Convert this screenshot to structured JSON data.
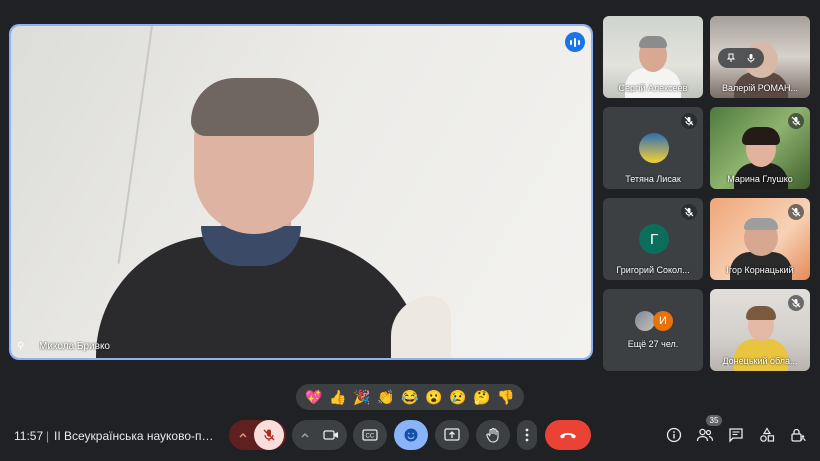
{
  "main": {
    "speaker_name": "Микола Бривко",
    "pin_glyph": "⚲"
  },
  "tiles": [
    {
      "name": "Сергій Алексеев",
      "type": "video"
    },
    {
      "name": "Валерій РОМАН...",
      "type": "video"
    },
    {
      "name": "Тетяна Лисак",
      "type": "avatar-image"
    },
    {
      "name": "Марина Глушко",
      "type": "video"
    },
    {
      "name": "Григорий Сокол...",
      "type": "avatar",
      "initial": "Г",
      "avatar_color": "#0b6e5a"
    },
    {
      "name": "Ігор Корнацький",
      "type": "video"
    },
    {
      "name": "Ещё 27 чел.",
      "type": "more",
      "initial": "И",
      "avatar_color": "#e8710a"
    },
    {
      "name": "Донецький обла...",
      "type": "video"
    }
  ],
  "reactions": [
    "💖",
    "👍",
    "🎉",
    "👏",
    "😂",
    "😮",
    "😢",
    "🤔",
    "👎"
  ],
  "bottom": {
    "time": "11:57",
    "separator": "|",
    "meeting_title": "II Всеукраїнська науково-практ...",
    "participant_count": "35"
  },
  "colors": {
    "accent": "#8ab4f8",
    "end_call": "#ea4335",
    "background": "#202124",
    "tile": "#3c4043"
  }
}
